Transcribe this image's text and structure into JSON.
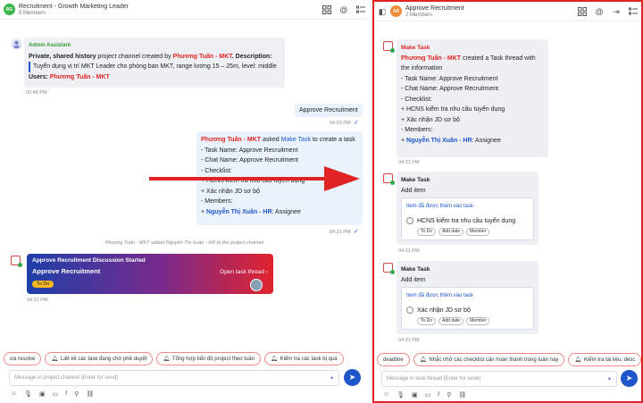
{
  "left": {
    "header": {
      "avatar_text": "RG",
      "title": "Recruitment - Growth Marketing Leader",
      "members": "5 Members"
    },
    "admin_msg": {
      "sender": "Admin Assistant",
      "line1_prefix": "Private, shared history",
      "line1_mid": " project channel created by ",
      "line1_creator": "Phương Tuấn - MKT",
      "line1_desc": ". Description:",
      "desc_text": "Tuyển dụng vị trí MKT Leader cho phòng ban MKT, range lương 15 – 25m, level: middle",
      "users_label": "Users: ",
      "users_value": "Phương Tuấn - MKT",
      "time": "02:48 PM"
    },
    "approve_msg": {
      "text": "Approve Recruitment",
      "time": "04:03 PM"
    },
    "task_msg": {
      "actor": "Phương Tuấn - MKT",
      "asked": " asked ",
      "bot": "Make Task",
      "rest": " to create a task",
      "lines": [
        "- Task Name: Approve Recruitment",
        "- Chat Name: Approve Recruitment",
        "- Checklist:",
        "+ HCNS kiểm tra nhu cầu tuyển dụng",
        "+ Xác nhận JD sơ bộ",
        "- Members:"
      ],
      "assignee": "Nguyễn Thị Xuân - HR",
      "assignee_suffix": ": Assignee",
      "time": "04:31 PM"
    },
    "system_note": "Phương Tuấn - MKT added Nguyễn Thị Xuân - HR to the project channel",
    "discussion_card": {
      "header": "Approve Recruitment Discussion Started",
      "title": "Approve Recruitment",
      "link": "Open task thread",
      "status": "To Do",
      "time": "04:31 PM"
    },
    "suggestions": [
      "ưa resolve",
      "Liệt kê các task đang chờ phê duyệt",
      "Tổng hợp tiến độ project theo tuần",
      "Kiểm tra các task bị quá"
    ],
    "input_placeholder": "Message in project channel (Enter for send)"
  },
  "right": {
    "header": {
      "avatar_text": "AR",
      "title": "Approve Recruitment",
      "members": "2 Members"
    },
    "msg1": {
      "sender": "Make Task",
      "actor": "Phương Tuấn - MKT",
      "intro": " created a Task thread with the information",
      "lines": [
        "- Task Name: Approve Recruitment",
        "- Chat Name: Approve Recruitment",
        "- Checklist:",
        "+ HCNS kiểm tra nhu cầu tuyển dụng",
        "+ Xác nhận JD sơ bộ",
        "- Members:"
      ],
      "assignee": "Nguyễn Thị Xuân - HR",
      "assignee_suffix": ": Assignee",
      "time": "04:31 PM"
    },
    "msg2": {
      "sender": "Make Task",
      "text": "Add item",
      "card_header": "Item đã được thêm vào task",
      "item": "HCNS kiểm tra nhu cầu tuyển dụng",
      "pills": [
        "To Do",
        "Add date",
        "Member"
      ],
      "time": "04:31 PM"
    },
    "msg3": {
      "sender": "Make Task",
      "text": "Add item",
      "card_header": "Item đã được thêm vào task",
      "item": "Xác nhận JD sơ bộ",
      "pills": [
        "To Do",
        "Add date",
        "Member"
      ],
      "time": "04:31 PM"
    },
    "suggestions": [
      "deadline",
      "Nhắc nhở các checklist cần hoàn thành trong tuần này",
      "Kiểm tra tài liệu, desc"
    ],
    "input_placeholder": "Message in task thread (Enter for send)"
  },
  "colors": {
    "accent_red": "#e02424",
    "link_blue": "#1f56c9",
    "card_gradient_start": "#1e3fa8",
    "card_gradient_end": "#e0232e"
  }
}
